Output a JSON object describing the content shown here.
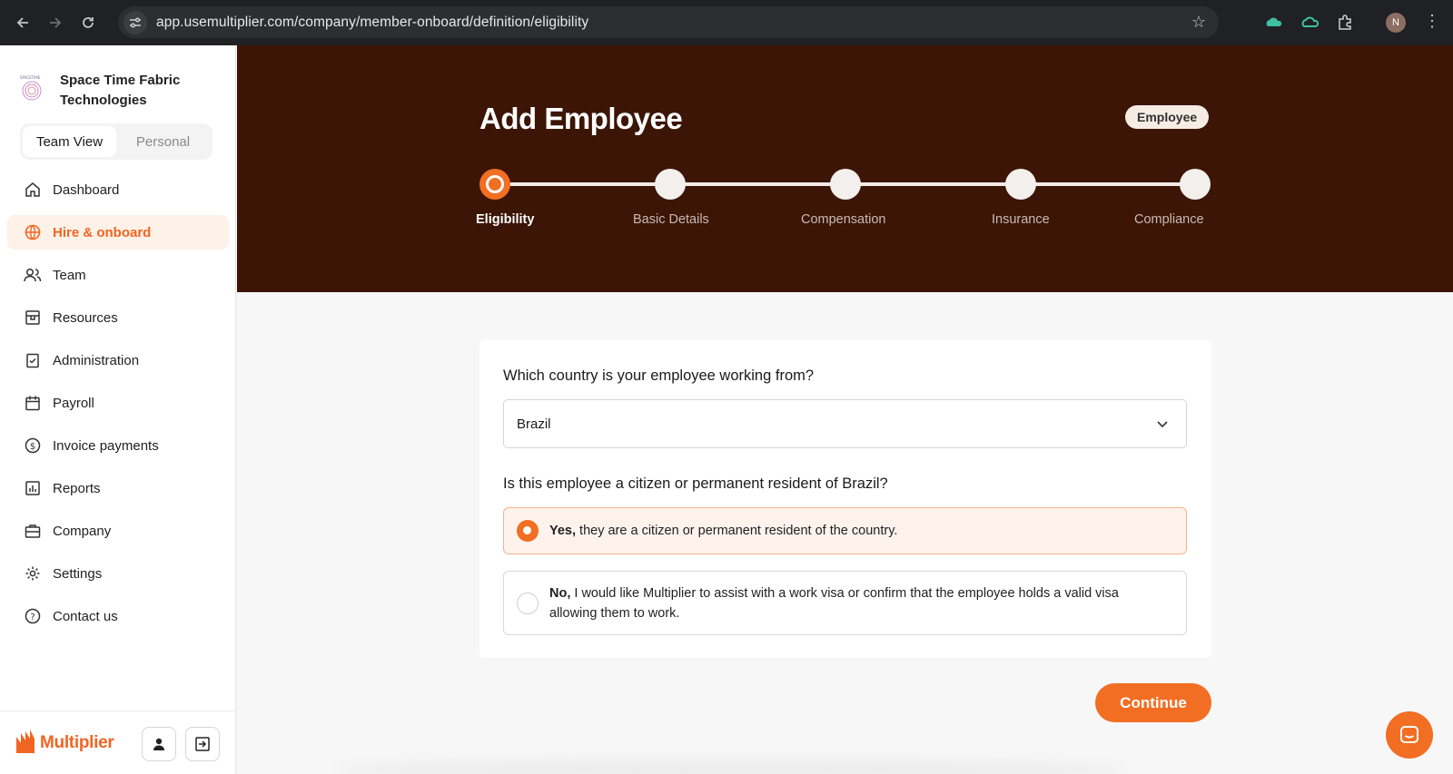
{
  "browser": {
    "url": "app.usemultiplier.com/company/member-onboard/definition/eligibility",
    "profile_initial": "N"
  },
  "sidebar": {
    "company_name": "Space Time Fabric Technologies",
    "view_toggle": {
      "team": "Team View",
      "personal": "Personal",
      "selected": "Team View"
    },
    "items": [
      {
        "label": "Dashboard",
        "icon": "home-icon"
      },
      {
        "label": "Hire & onboard",
        "icon": "globe-icon",
        "active": true
      },
      {
        "label": "Team",
        "icon": "users-icon"
      },
      {
        "label": "Resources",
        "icon": "box-icon"
      },
      {
        "label": "Administration",
        "icon": "clipboard-check-icon"
      },
      {
        "label": "Payroll",
        "icon": "calendar-icon"
      },
      {
        "label": "Invoice payments",
        "icon": "dollar-circle-icon"
      },
      {
        "label": "Reports",
        "icon": "bar-chart-icon"
      },
      {
        "label": "Company",
        "icon": "briefcase-icon"
      },
      {
        "label": "Settings",
        "icon": "gear-icon"
      },
      {
        "label": "Contact us",
        "icon": "help-circle-icon"
      }
    ],
    "footer_logo": "Multiplier"
  },
  "header": {
    "title": "Add Employee",
    "badge": "Employee",
    "steps": [
      {
        "label": "Eligibility",
        "active": true
      },
      {
        "label": "Basic Details"
      },
      {
        "label": "Compensation"
      },
      {
        "label": "Insurance"
      },
      {
        "label": "Compliance"
      }
    ]
  },
  "form": {
    "country_question": "Which country is your employee working from?",
    "country_value": "Brazil",
    "citizen_question": "Is this employee a citizen or permanent resident of Brazil?",
    "options": [
      {
        "bold": "Yes,",
        "text": " they are a citizen or permanent resident of the country.",
        "selected": true
      },
      {
        "bold": "No,",
        "text": " I would like Multiplier to assist with a work visa or confirm that the employee holds a valid visa allowing them to work.",
        "selected": false
      }
    ],
    "continue_label": "Continue"
  },
  "colors": {
    "accent": "#f26e22",
    "header_bg": "#3c1506",
    "chrome_bg": "#202124"
  }
}
